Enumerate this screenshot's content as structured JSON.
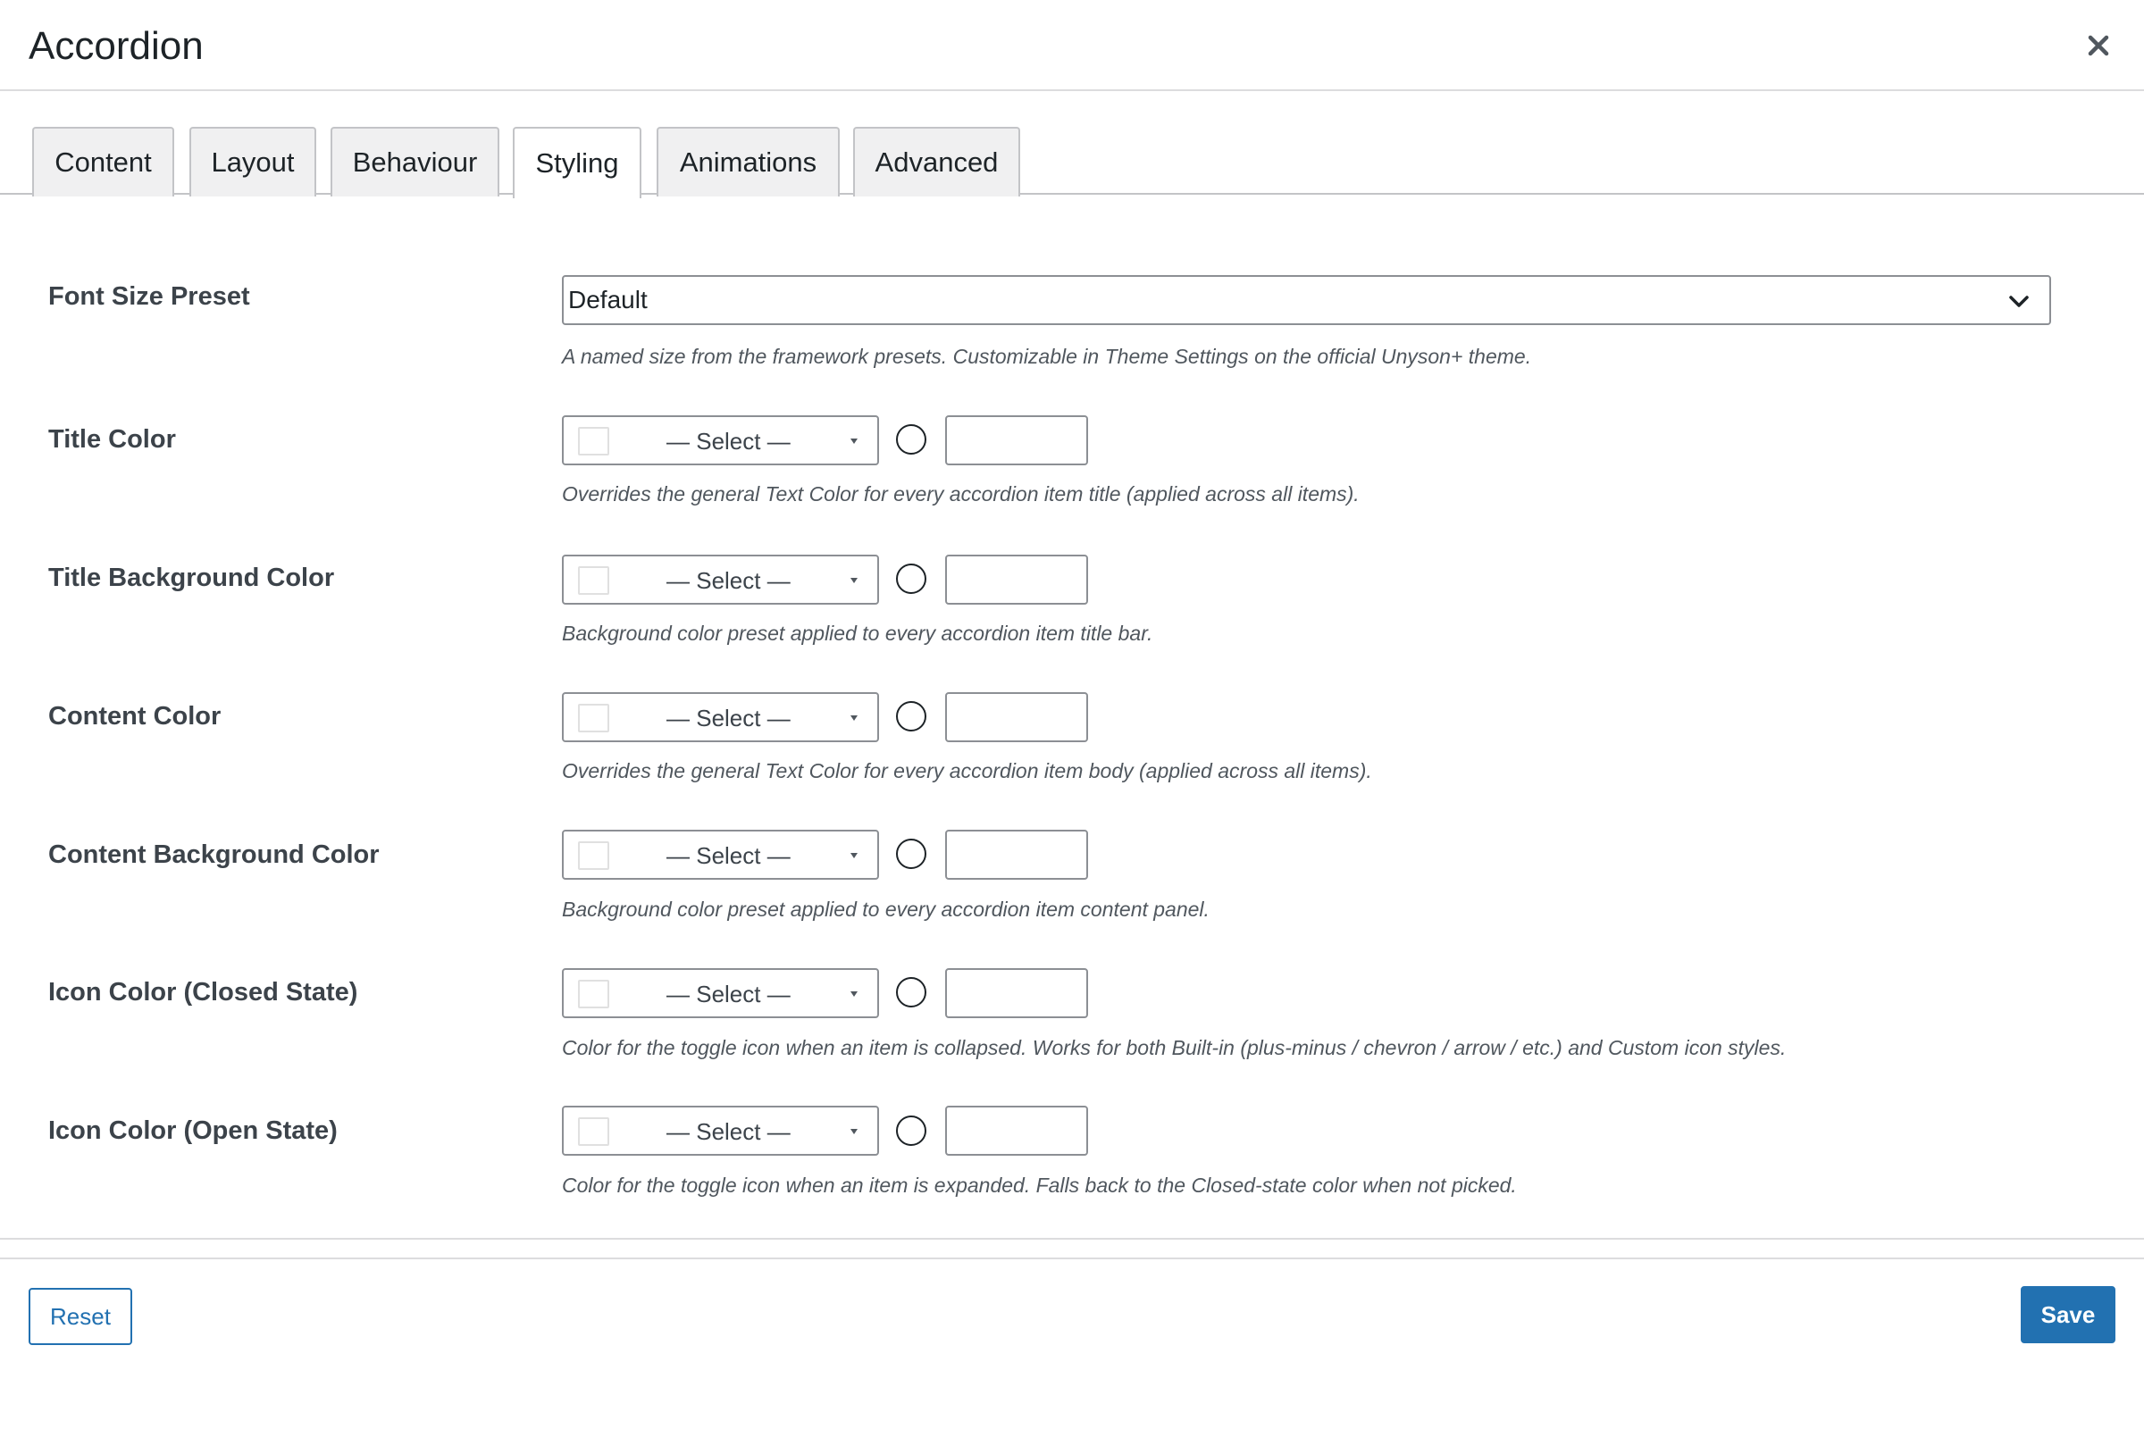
{
  "modal": {
    "title": "Accordion"
  },
  "tabs": [
    {
      "label": "Content"
    },
    {
      "label": "Layout"
    },
    {
      "label": "Behaviour"
    },
    {
      "label": "Styling",
      "active": true
    },
    {
      "label": "Animations"
    },
    {
      "label": "Advanced"
    }
  ],
  "font_size_preset": {
    "label": "Font Size Preset",
    "value": "Default",
    "description": "A named size from the framework presets. Customizable in Theme Settings on the official Unyson+ theme."
  },
  "color_fields": [
    {
      "label": "Title Color",
      "select_label": "— Select —",
      "hex_value": "",
      "description": "Overrides the general Text Color for every accordion item title (applied across all items)."
    },
    {
      "label": "Title Background Color",
      "select_label": "— Select —",
      "hex_value": "",
      "description": "Background color preset applied to every accordion item title bar."
    },
    {
      "label": "Content Color",
      "select_label": "— Select —",
      "hex_value": "",
      "description": "Overrides the general Text Color for every accordion item body (applied across all items)."
    },
    {
      "label": "Content Background Color",
      "select_label": "— Select —",
      "hex_value": "",
      "description": "Background color preset applied to every accordion item content panel."
    },
    {
      "label": "Icon Color (Closed State)",
      "select_label": "— Select —",
      "hex_value": "",
      "description": "Color for the toggle icon when an item is collapsed. Works for both Built-in (plus-minus / chevron / arrow / etc.) and Custom icon styles."
    },
    {
      "label": "Icon Color (Open State)",
      "select_label": "— Select —",
      "hex_value": "",
      "description": "Color for the toggle icon when an item is expanded. Falls back to the Closed-state color when not picked."
    }
  ],
  "footer": {
    "reset_label": "Reset",
    "save_label": "Save"
  },
  "colors": {
    "accent": "#2271b1",
    "border": "#8c8f94",
    "tab_bg": "#f0f0f1"
  }
}
